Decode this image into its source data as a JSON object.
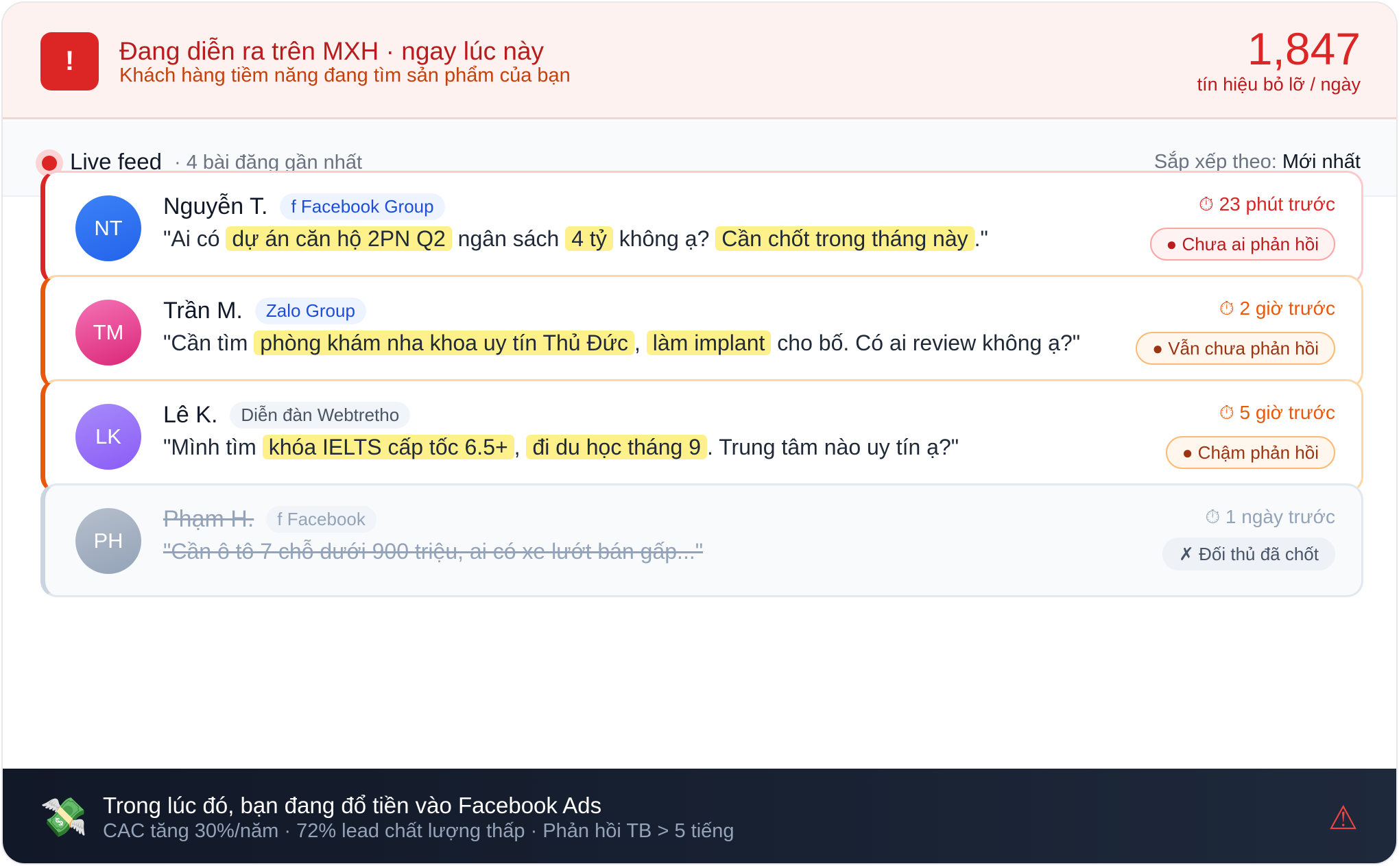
{
  "header": {
    "alert_symbol": "!",
    "title": "Đang diễn ra trên MXH · ngay lúc này",
    "subtitle": "Khách hàng tiềm năng đang tìm sản phẩm của bạn",
    "count": "1,847",
    "count_label": "tín hiệu bỏ lỡ / ngày"
  },
  "feed": {
    "live_label": "Live feed",
    "live_sub": "· 4 bài đăng gần nhất",
    "sort_label": "Sắp xếp theo:",
    "sort_value": "Mới nhất"
  },
  "posts": [
    {
      "initials": "NT",
      "name": "Nguyễn T.",
      "source": "f Facebook Group",
      "quote": [
        "\"Ai có ",
        "dự án căn hộ 2PN Q2",
        " ngân sách ",
        "4 tỷ",
        " không ạ? ",
        "Cần chốt trong tháng này",
        ".\""
      ],
      "time": "⏱ 23 phút trước",
      "status": "● Chưa ai phản hồi"
    },
    {
      "initials": "TM",
      "name": "Trần M.",
      "source": "Zalo Group",
      "quote": [
        "\"Cần tìm ",
        "phòng khám nha khoa uy tín Thủ Đức",
        ", ",
        "làm implant",
        " cho bố. Có ai review không ạ?\""
      ],
      "time": "⏱ 2 giờ trước",
      "status": "● Vẫn chưa phản hồi"
    },
    {
      "initials": "LK",
      "name": "Lê K.",
      "source": "Diễn đàn Webtretho",
      "quote": [
        "\"Mình tìm ",
        "khóa IELTS cấp tốc 6.5+",
        ", ",
        "đi du học tháng 9",
        ". Trung tâm nào uy tín ạ?\""
      ],
      "time": "⏱ 5 giờ trước",
      "status": "● Chậm phản hồi"
    },
    {
      "initials": "PH",
      "name": "Phạm H.",
      "source": "f Facebook",
      "quote_text": "\"Cần ô tô 7 chỗ dưới 900 triệu, ai có xe lướt bán gấp...\"",
      "time": "⏱ 1 ngày trước",
      "status": "✗ Đối thủ đã chốt"
    }
  ],
  "footer": {
    "icon": "💸",
    "title": "Trong lúc đó, bạn đang đổ tiền vào Facebook Ads",
    "subtitle": "CAC tăng 30%/năm · 72% lead chất lượng thấp · Phản hồi TB > 5 tiếng",
    "warning_icon": "⚠"
  }
}
